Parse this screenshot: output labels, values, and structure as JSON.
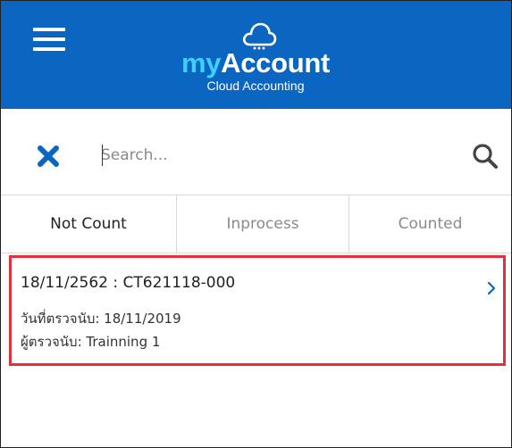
{
  "header": {
    "brand_my": "my",
    "brand_account": "Account",
    "tagline": "Cloud Accounting",
    "color": "#0b66c2",
    "icons": [
      "menu-icon",
      "cloud-icon"
    ]
  },
  "search": {
    "placeholder": "Search...",
    "value": "",
    "icons": [
      "close-icon",
      "search-icon"
    ]
  },
  "tabs": [
    {
      "label": "Not Count",
      "active": true
    },
    {
      "label": "Inprocess",
      "active": false
    },
    {
      "label": "Counted",
      "active": false
    }
  ],
  "list": {
    "items": [
      {
        "title": "18/11/2562 : CT621118-000",
        "count_date": "วันที่ตรวจนับ: 18/11/2019",
        "counter": "ผู้ตรวจนับ: Trainning 1",
        "highlight_color": "#e0303a"
      }
    ]
  }
}
